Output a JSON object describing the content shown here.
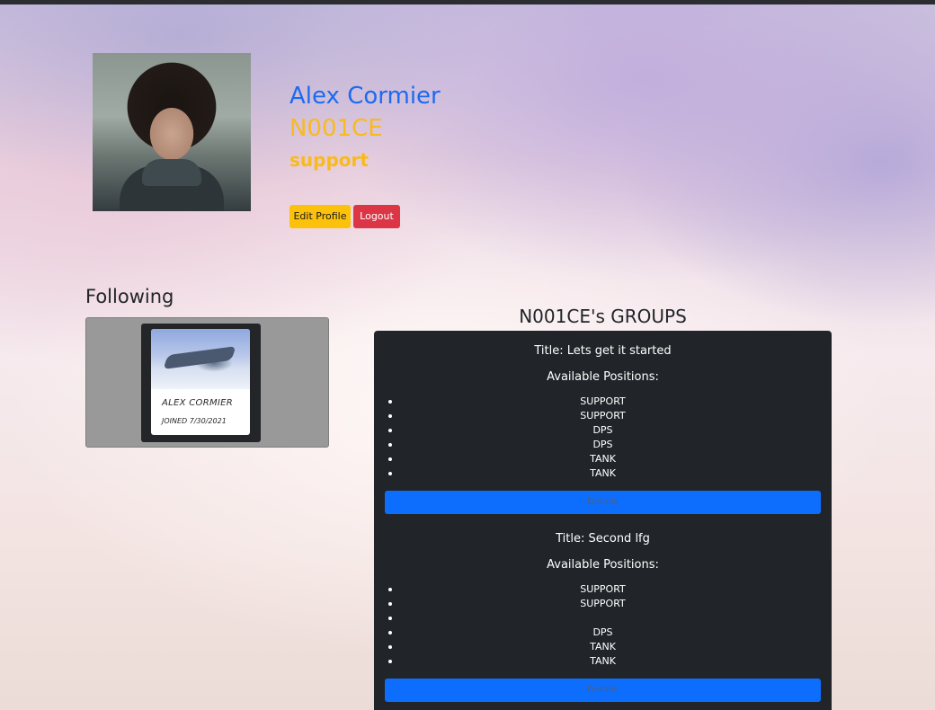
{
  "profile": {
    "name": "Alex Cormier",
    "tag": "N001CE",
    "role": "support",
    "edit_label": "Edit Profile",
    "logout_label": "Logout"
  },
  "following": {
    "title": "Following",
    "cards": [
      {
        "name": "ALEX CORMIER",
        "joined": "JOINED 7/30/2021"
      }
    ]
  },
  "groups": {
    "title": "N001CE's GROUPS",
    "available_label": "Available Positions:",
    "details_label": "Details",
    "items": [
      {
        "title": "Title: Lets get it started",
        "positions": [
          "SUPPORT",
          "SUPPORT",
          "DPS",
          "DPS",
          "TANK",
          "TANK"
        ]
      },
      {
        "title": "Title: Second lfg",
        "positions": [
          "SUPPORT",
          "SUPPORT",
          "",
          "DPS",
          "TANK",
          "TANK"
        ]
      }
    ]
  },
  "colors": {
    "name": "#1d6af0",
    "accent": "#f9ba1c",
    "edit_button": "#fcc10a",
    "logout_button": "#dc3545",
    "panel": "#212529",
    "details_button": "#0d6efd"
  }
}
